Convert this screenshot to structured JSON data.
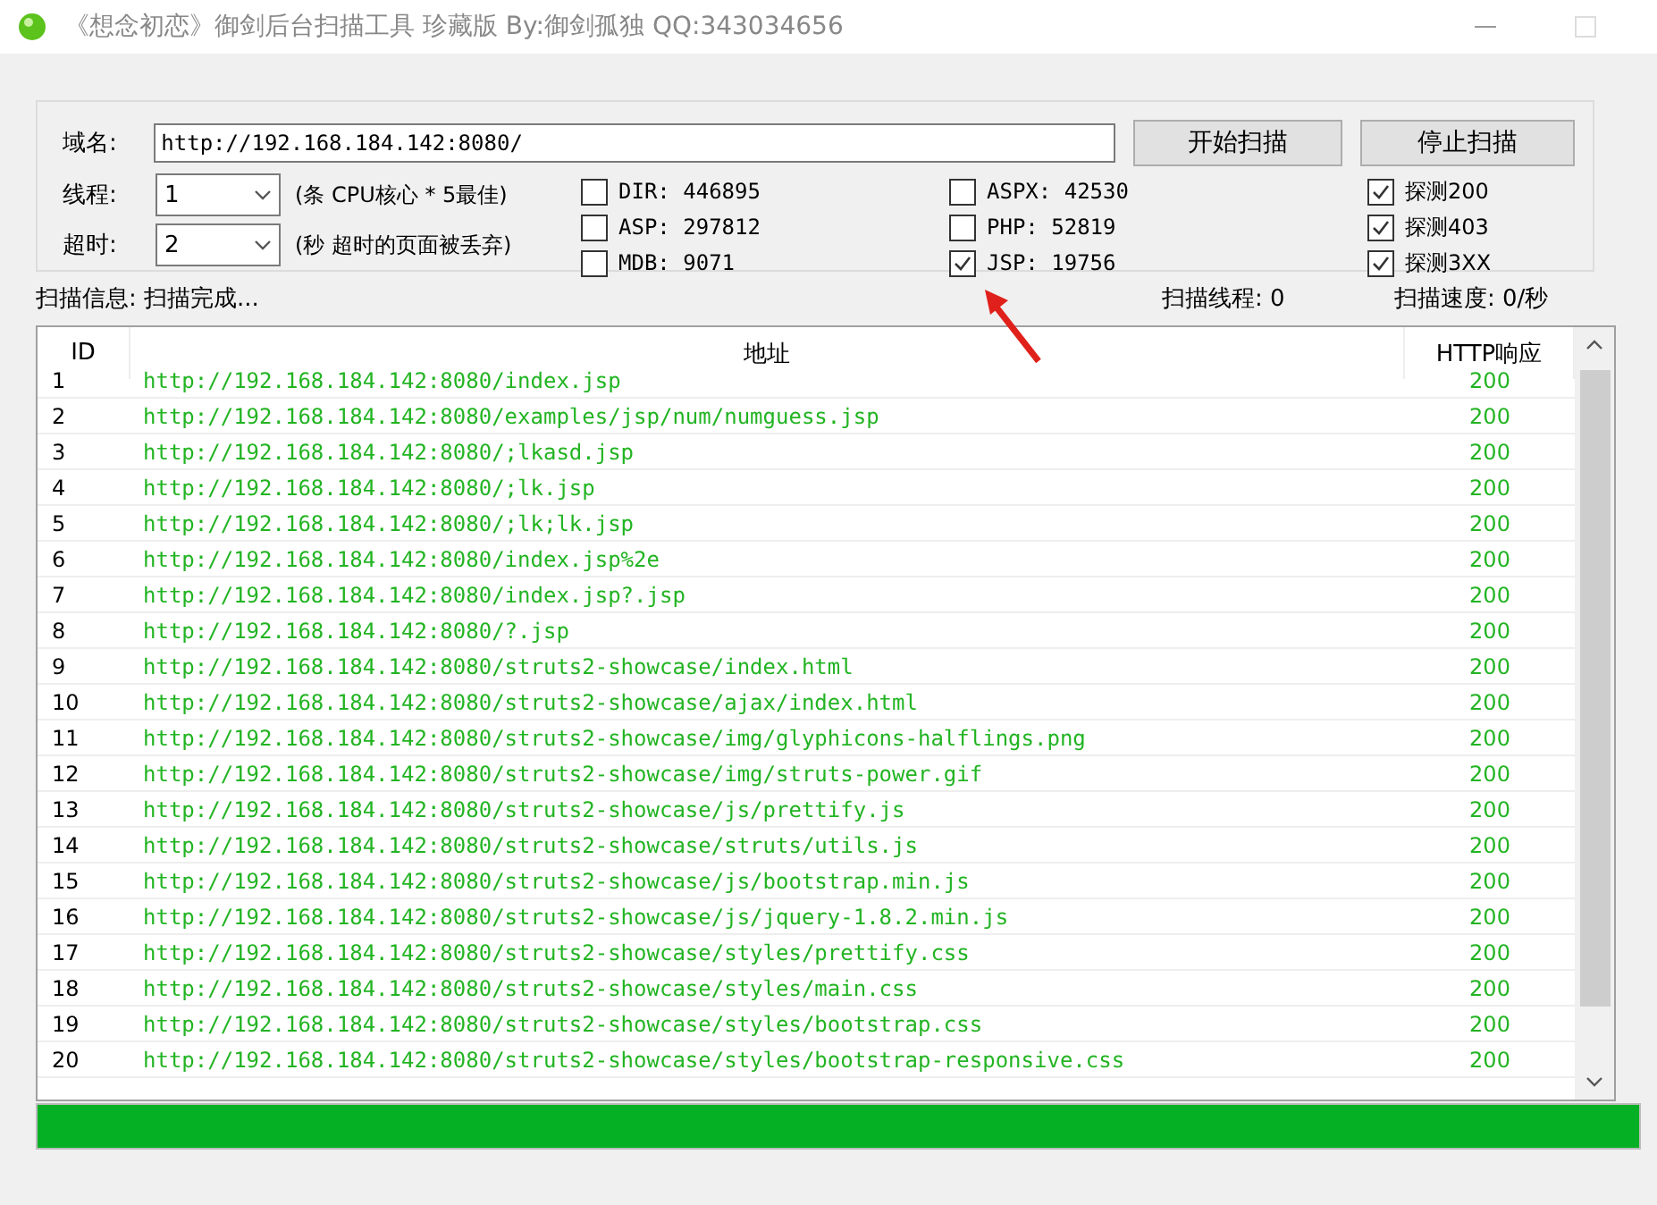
{
  "window": {
    "title": "《想念初恋》御剑后台扫描工具 珍藏版 By:御剑孤独 QQ:343034656"
  },
  "form": {
    "domain_label": "域名:",
    "domain_value": "http://192.168.184.142:8080/",
    "start_button": "开始扫描",
    "stop_button": "停止扫描",
    "threads_label": "线程:",
    "threads_value": "1",
    "threads_hint": "(条 CPU核心 * 5最佳)",
    "timeout_label": "超时:",
    "timeout_value": "2",
    "timeout_hint": "(秒 超时的页面被丢弃)"
  },
  "dictionaries": [
    {
      "label": "DIR: 446895",
      "checked": false
    },
    {
      "label": "ASP: 297812",
      "checked": false
    },
    {
      "label": "MDB: 9071",
      "checked": false
    },
    {
      "label": "ASPX: 42530",
      "checked": false
    },
    {
      "label": "PHP: 52819",
      "checked": false
    },
    {
      "label": "JSP: 19756",
      "checked": true
    }
  ],
  "probes": [
    {
      "label": "探测200",
      "checked": true
    },
    {
      "label": "探测403",
      "checked": true
    },
    {
      "label": "探测3XX",
      "checked": true
    }
  ],
  "status": {
    "info": "扫描信息: 扫描完成...",
    "threads": "扫描线程: 0",
    "speed": "扫描速度: 0/秒"
  },
  "table": {
    "columns": [
      "ID",
      "地址",
      "HTTP响应"
    ],
    "rows": [
      [
        "1",
        "http://192.168.184.142:8080/index.jsp",
        "200"
      ],
      [
        "2",
        "http://192.168.184.142:8080/examples/jsp/num/numguess.jsp",
        "200"
      ],
      [
        "3",
        "http://192.168.184.142:8080/;lkasd.jsp",
        "200"
      ],
      [
        "4",
        "http://192.168.184.142:8080/;lk.jsp",
        "200"
      ],
      [
        "5",
        "http://192.168.184.142:8080/;lk;lk.jsp",
        "200"
      ],
      [
        "6",
        "http://192.168.184.142:8080/index.jsp%2e",
        "200"
      ],
      [
        "7",
        "http://192.168.184.142:8080/index.jsp?.jsp",
        "200"
      ],
      [
        "8",
        "http://192.168.184.142:8080/?.jsp",
        "200"
      ],
      [
        "9",
        "http://192.168.184.142:8080/struts2-showcase/index.html",
        "200"
      ],
      [
        "10",
        "http://192.168.184.142:8080/struts2-showcase/ajax/index.html",
        "200"
      ],
      [
        "11",
        "http://192.168.184.142:8080/struts2-showcase/img/glyphicons-halflings.png",
        "200"
      ],
      [
        "12",
        "http://192.168.184.142:8080/struts2-showcase/img/struts-power.gif",
        "200"
      ],
      [
        "13",
        "http://192.168.184.142:8080/struts2-showcase/js/prettify.js",
        "200"
      ],
      [
        "14",
        "http://192.168.184.142:8080/struts2-showcase/struts/utils.js",
        "200"
      ],
      [
        "15",
        "http://192.168.184.142:8080/struts2-showcase/js/bootstrap.min.js",
        "200"
      ],
      [
        "16",
        "http://192.168.184.142:8080/struts2-showcase/js/jquery-1.8.2.min.js",
        "200"
      ],
      [
        "17",
        "http://192.168.184.142:8080/struts2-showcase/styles/prettify.css",
        "200"
      ],
      [
        "18",
        "http://192.168.184.142:8080/struts2-showcase/styles/main.css",
        "200"
      ],
      [
        "19",
        "http://192.168.184.142:8080/struts2-showcase/styles/bootstrap.css",
        "200"
      ],
      [
        "20",
        "http://192.168.184.142:8080/struts2-showcase/styles/bootstrap-responsive.css",
        "200"
      ]
    ]
  },
  "progress": {
    "level": 1
  }
}
